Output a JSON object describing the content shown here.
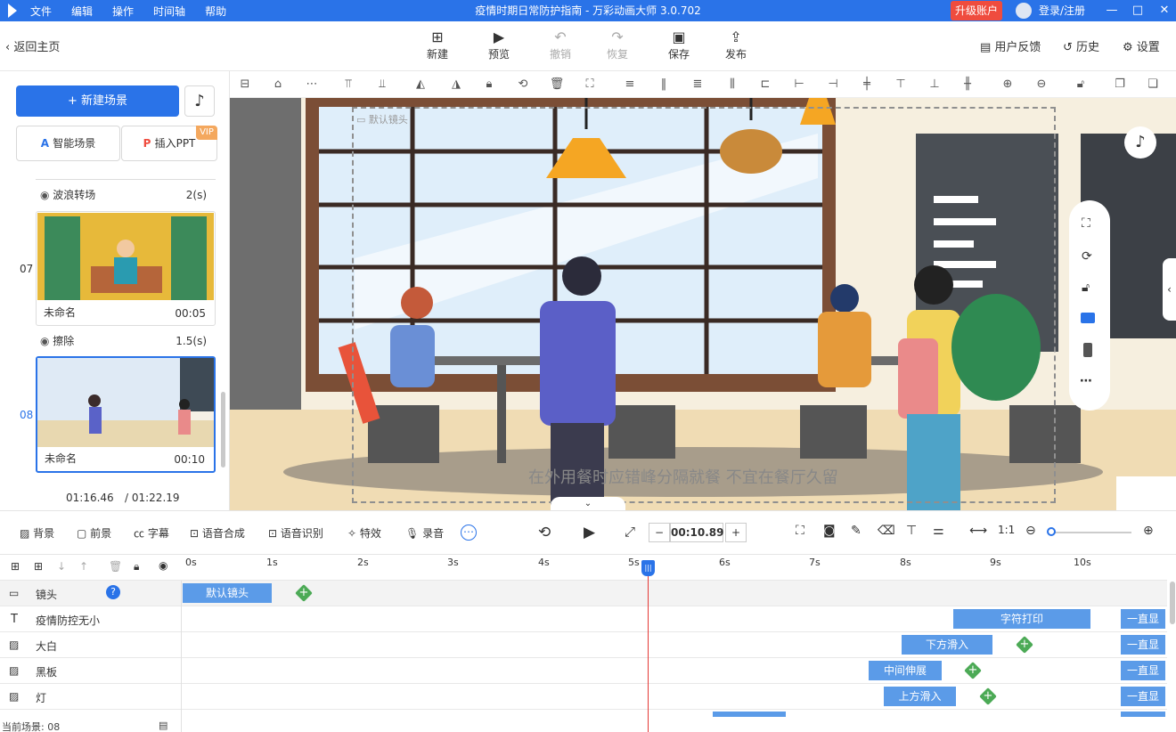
{
  "titlebar": {
    "menu": [
      "文件",
      "编辑",
      "操作",
      "时间轴",
      "帮助"
    ],
    "title": "疫情时期日常防护指南 - 万彩动画大师 3.0.702",
    "upgrade": "升级账户",
    "login": "登录/注册"
  },
  "toolbar": {
    "back": "返回主页",
    "buttons": [
      "新建",
      "预览",
      "撤销",
      "恢复",
      "保存",
      "发布"
    ],
    "right": [
      "用户反馈",
      "历史",
      "设置"
    ]
  },
  "left": {
    "new_scene": "新建场景",
    "smart_scene": "智能场景",
    "insert_ppt": "插入PPT",
    "vip": "VIP",
    "transitions": [
      {
        "name": "波浪转场",
        "dur": "2(s)"
      },
      {
        "name": "擦除",
        "dur": "1.5(s)"
      }
    ],
    "scenes": [
      {
        "num": "07",
        "name": "未命名",
        "time": "00:05"
      },
      {
        "num": "08",
        "name": "未命名",
        "time": "00:10"
      }
    ],
    "time_current": "01:16.46",
    "time_total": "/ 01:22.19"
  },
  "canvas": {
    "camera_label": "默认镜头",
    "subtitle": "在外用餐时应错峰分隔就餐 不宜在餐厅久留"
  },
  "timeline_controls": {
    "left_tools": [
      "背景",
      "前景",
      "字幕",
      "语音合成",
      "语音识别",
      "特效",
      "录音"
    ],
    "time": "00:10.89",
    "minus": "−",
    "plus": "+"
  },
  "timeline": {
    "ticks": [
      "0s",
      "1s",
      "2s",
      "3s",
      "4s",
      "5s",
      "6s",
      "7s",
      "8s",
      "9s",
      "10s"
    ],
    "layers": [
      {
        "name": "镜头"
      },
      {
        "name": "疫情防控无小"
      },
      {
        "name": "大白"
      },
      {
        "name": "黑板"
      },
      {
        "name": "灯"
      }
    ],
    "blocks": {
      "camera": "默认镜头",
      "text": "字符打印",
      "dabai": "下方滑入",
      "board": "中间伸展",
      "lamp": "上方滑入",
      "always": "一直显"
    },
    "status": "当前场景: 08"
  },
  "colors": {
    "accent": "#2a73e8",
    "upgrade": "#ef4c3e",
    "playhead": "#e53935",
    "block": "#5b9be8"
  }
}
